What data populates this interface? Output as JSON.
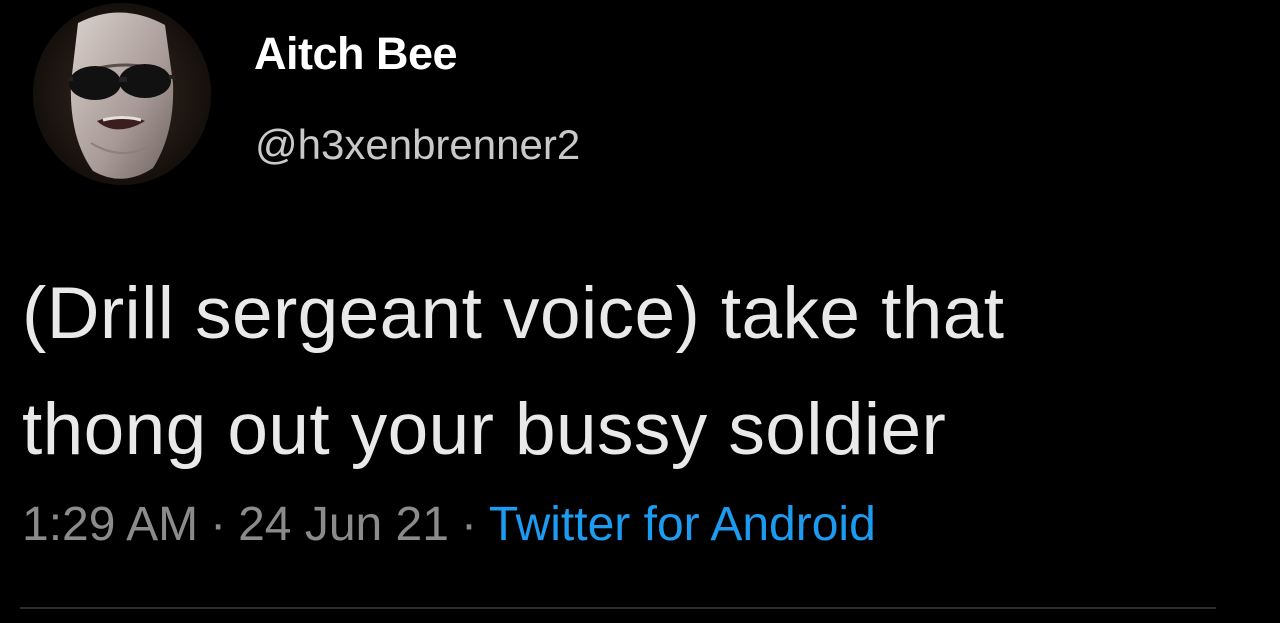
{
  "user": {
    "display_name": "Aitch Bee",
    "handle": "@h3xenbrenner2",
    "avatar_icon": "profile-photo-avatar"
  },
  "tweet": {
    "lines": [
      "(Drill sergeant voice) take that",
      "thong out your bussy soldier"
    ]
  },
  "meta": {
    "time": "1:29 AM",
    "separator": "·",
    "date": "24 Jun 21",
    "source": "Twitter for Android"
  },
  "colors": {
    "background": "#000000",
    "text": "#e7e9ea",
    "secondary_text": "#8b8b8b",
    "link": "#1d9bf0"
  }
}
